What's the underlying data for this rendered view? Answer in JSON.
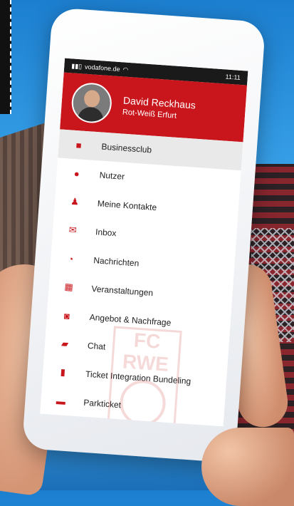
{
  "status_bar": {
    "carrier": "vodafone.de",
    "time": "11:11"
  },
  "header": {
    "user_name": "David Reckhaus",
    "club": "Rot-Weiß Erfurt"
  },
  "menu": {
    "items": [
      {
        "label": "Businessclub",
        "icon": "briefcase-icon"
      },
      {
        "label": "Nutzer",
        "icon": "user-icon"
      },
      {
        "label": "Meine Kontakte",
        "icon": "contacts-icon"
      },
      {
        "label": "Inbox",
        "icon": "mail-icon"
      },
      {
        "label": "Nachrichten",
        "icon": "rss-icon"
      },
      {
        "label": "Veranstaltungen",
        "icon": "calendar-icon"
      },
      {
        "label": "Angebot & Nachfrage",
        "icon": "camera-icon"
      },
      {
        "label": "Chat",
        "icon": "chat-icon"
      },
      {
        "label": "Ticket Integration Bundeling",
        "icon": "document-icon"
      },
      {
        "label": "Parkticket",
        "icon": "car-icon"
      }
    ]
  },
  "watermark": {
    "line1": "FC",
    "line2": "RWE"
  },
  "colors": {
    "accent": "#c9161c",
    "status_bar": "#1a1a1a",
    "active_row": "#e9e9e9"
  }
}
